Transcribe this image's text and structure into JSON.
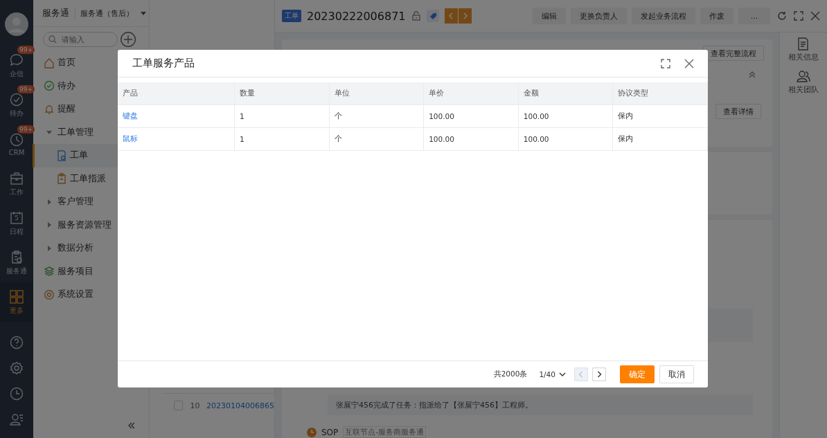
{
  "rail": {
    "items": [
      {
        "label": "企信",
        "badge": "99+",
        "selected": false
      },
      {
        "label": "待办",
        "badge": "99+",
        "selected": false
      },
      {
        "label": "CRM",
        "badge": "99+",
        "selected": false
      },
      {
        "label": "工作",
        "selected": false
      },
      {
        "label": "日程",
        "date": "5",
        "selected": false
      },
      {
        "label": "服务通",
        "selected": false
      },
      {
        "label": "更多",
        "selected": true
      }
    ]
  },
  "sidebar": {
    "app_title": "服务通",
    "app_switch": "服务通（售后）",
    "search": {
      "placeholder": "请输入"
    },
    "menu": [
      {
        "label": "首页",
        "selected": false
      },
      {
        "label": "待办",
        "selected": false
      },
      {
        "label": "提醒",
        "selected": false
      },
      {
        "label": "工单管理",
        "selected": false,
        "expanded": true,
        "children": [
          {
            "label": "工单",
            "selected": true
          },
          {
            "label": "工单指派",
            "selected": false
          }
        ]
      },
      {
        "label": "客户管理",
        "selected": false,
        "expanded": false
      },
      {
        "label": "服务资源管理",
        "selected": false,
        "expanded": false
      },
      {
        "label": "数据分析",
        "selected": false,
        "expanded": false
      },
      {
        "label": "服务项目",
        "selected": false
      },
      {
        "label": "系统设置",
        "selected": false
      }
    ]
  },
  "record_list": {
    "rows": [
      {
        "index": "10",
        "number": "20230104006865",
        "checked": false
      }
    ]
  },
  "detail": {
    "tag": "工单",
    "title": "20230222006871",
    "actions": [
      "编辑",
      "更换负责人",
      "发起业务流程",
      "作废",
      "..."
    ],
    "flow_button": "查看完整流程",
    "detail_button": "查看详情",
    "timeline": [
      {
        "kind": "task",
        "text": "张展宁456完成了任务：指派给了【张展宁456】工程师。"
      },
      {
        "kind": "sop",
        "title": "SOP",
        "tag": "互联节点-服务商服务通"
      }
    ],
    "side_tabs": [
      "相关信息",
      "相关团队"
    ]
  },
  "dialog": {
    "title": "工单服务产品",
    "columns": [
      "产品",
      "数量",
      "单位",
      "单价",
      "金额",
      "协议类型"
    ],
    "rows": [
      [
        "键盘",
        "1",
        "个",
        "100.00",
        "100.00",
        "保内"
      ],
      [
        "鼠标",
        "1",
        "个",
        "100.00",
        "100.00",
        "保内"
      ]
    ],
    "footer": {
      "total": "共2000条",
      "page": "1/40",
      "prev_disabled": true,
      "next_disabled": false,
      "confirm": "确定",
      "cancel": "取消"
    }
  }
}
